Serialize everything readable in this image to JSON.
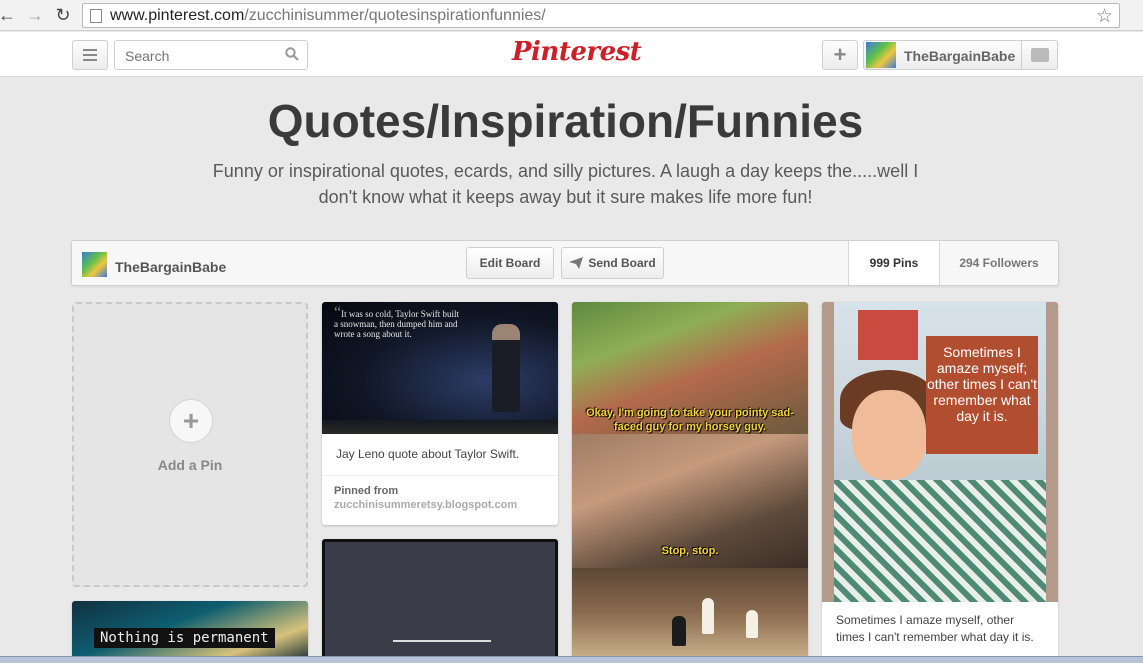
{
  "browser": {
    "url_host": "www.pinterest.com",
    "url_path": "/zucchinisummer/quotesinspirationfunnies/"
  },
  "header": {
    "search_placeholder": "Search",
    "logo_text": "Pinterest",
    "username": "TheBargainBabe"
  },
  "board": {
    "title": "Quotes/Inspiration/Funnies",
    "description": "Funny or inspirational quotes, ecards, and silly pictures. A laugh a day keeps the.....well I don't know what it keeps away but it sure makes life more fun!",
    "owner": "TheBargainBabe",
    "edit_label": "Edit Board",
    "send_label": "Send Board",
    "pins_count": "999 Pins",
    "followers_count": "294 Followers"
  },
  "add_pin": {
    "label": "Add a Pin"
  },
  "pins": [
    {
      "image_quote": "It was so cold, Taylor Swift built a snowman, then dumped him and wrote a song about it.",
      "description": "Jay Leno quote about Taylor Swift.",
      "pinned_label": "Pinned from",
      "source": "zucchinisummeretsy.blogspot.com"
    },
    {
      "caption_1": "Okay, I'm going to take your pointy sad-faced guy for my horsey guy.",
      "caption_2": "Stop, stop."
    },
    {
      "image_text": "Sometimes I amaze myself; other times I can't remember what day it is.",
      "description": "Sometimes I amaze myself, other times I can't remember what day it is."
    },
    {
      "image_text": "Nothing is permanent"
    }
  ]
}
